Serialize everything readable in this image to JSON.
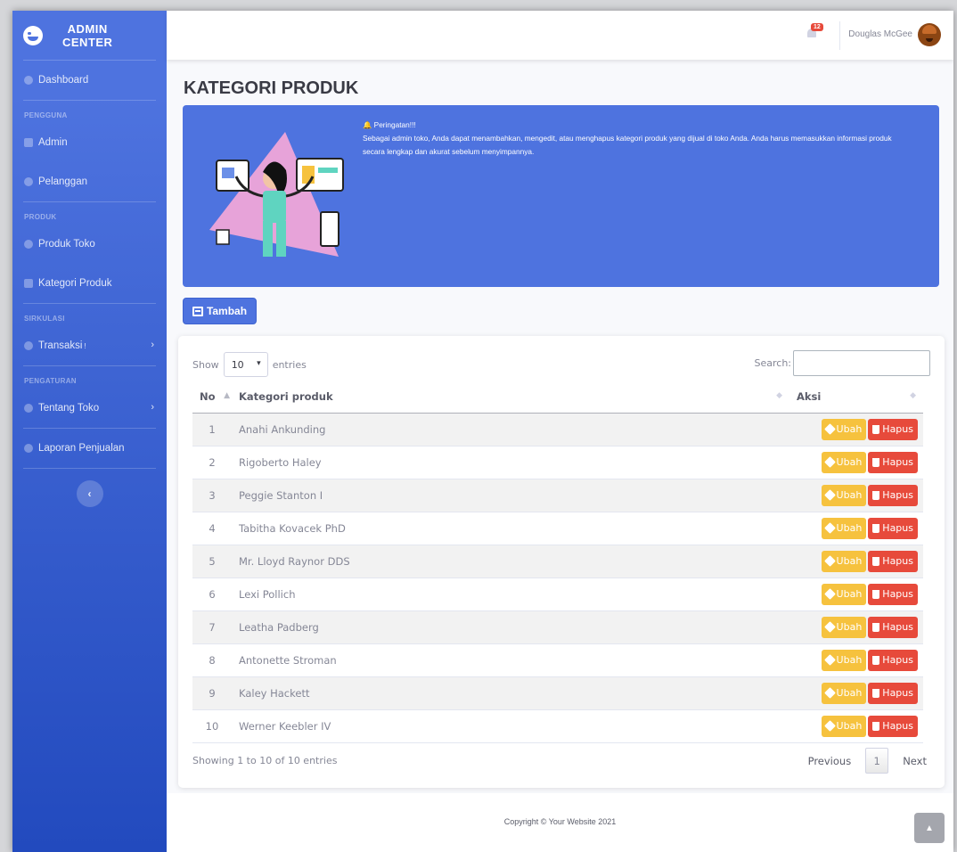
{
  "brand": {
    "line1": "ADMIN",
    "line2": "CENTER"
  },
  "sidebar": {
    "dashboard": "Dashboard",
    "heading_pengguna": "PENGGUNA",
    "admin": "Admin",
    "pelanggan": "Pelanggan",
    "heading_produk": "PRODUK",
    "produk_toko": "Produk Toko",
    "kategori_produk": "Kategori Produk",
    "heading_sirkulasi": "SIRKULASI",
    "transaksi": "Transaksi",
    "transaksi_badge": "!",
    "heading_pengaturan": "PENGATURAN",
    "tentang_toko": "Tentang Toko",
    "laporan": "Laporan Penjualan",
    "toggle": "‹"
  },
  "topbar": {
    "alert_count": "12",
    "user_name": "Douglas McGee"
  },
  "page": {
    "title": "KATEGORI PRODUK"
  },
  "alert": {
    "title": "Peringatan!!!",
    "message": "Sebagai admin toko, Anda dapat menambahkan, mengedit, atau menghapus kategori produk yang dijual di toko Anda. Anda harus memasukkan informasi produk secara lengkap dan akurat sebelum menyimpannya."
  },
  "buttons": {
    "tambah": "Tambah",
    "ubah": "Ubah",
    "hapus": "Hapus"
  },
  "table": {
    "show": "Show",
    "length": "10",
    "entries": "entries",
    "search": "Search:",
    "headers": {
      "no": "No",
      "kategori": "Kategori produk",
      "aksi": "Aksi"
    },
    "rows": [
      {
        "no": "1",
        "name": "Anahi Ankunding"
      },
      {
        "no": "2",
        "name": "Rigoberto Haley"
      },
      {
        "no": "3",
        "name": "Peggie Stanton I"
      },
      {
        "no": "4",
        "name": "Tabitha Kovacek PhD"
      },
      {
        "no": "5",
        "name": "Mr. Lloyd Raynor DDS"
      },
      {
        "no": "6",
        "name": "Lexi Pollich"
      },
      {
        "no": "7",
        "name": "Leatha Padberg"
      },
      {
        "no": "8",
        "name": "Antonette Stroman"
      },
      {
        "no": "9",
        "name": "Kaley Hackett"
      },
      {
        "no": "10",
        "name": "Werner Keebler IV"
      }
    ],
    "info": "Showing 1 to 10 of 10 entries",
    "previous": "Previous",
    "page": "1",
    "next": "Next"
  },
  "footer": {
    "copyright": "Copyright © Your Website 2021"
  },
  "colors": {
    "primary": "#4e73df",
    "warning": "#f6c23e",
    "danger": "#e74a3b"
  }
}
